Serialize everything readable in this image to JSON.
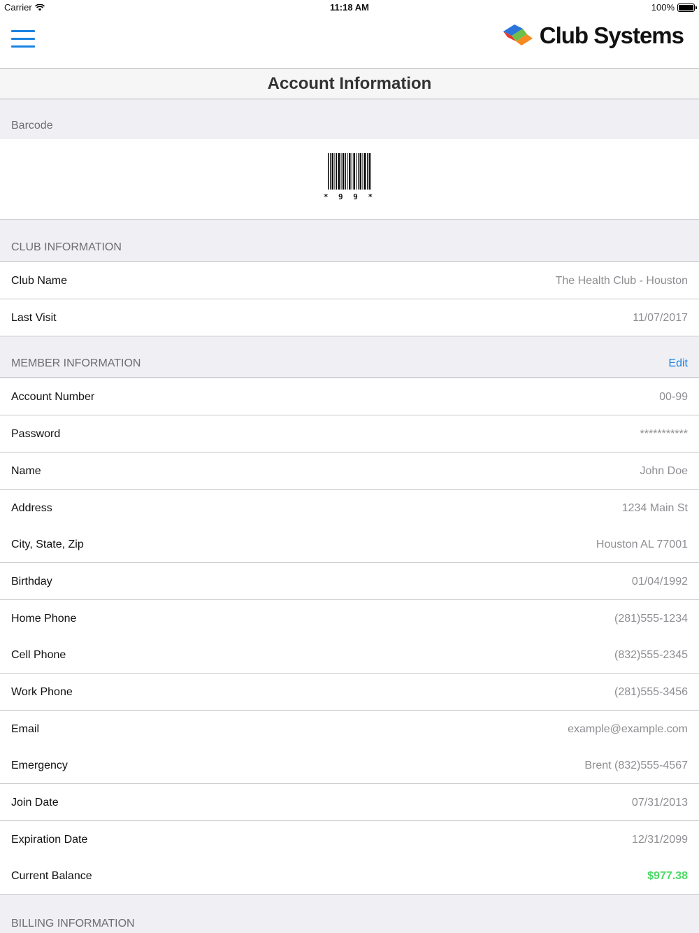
{
  "status_bar": {
    "carrier": "Carrier",
    "time": "11:18 AM",
    "battery": "100%"
  },
  "header": {
    "logo_text": "Club Systems",
    "menu_icon": "hamburger-menu-icon"
  },
  "page_title": "Account Information",
  "barcode": {
    "section_label": "Barcode",
    "text": "* 9 9 *"
  },
  "club": {
    "section_label": "CLUB INFORMATION",
    "rows": [
      {
        "label": "Club Name",
        "value": "The Health Club - Houston"
      },
      {
        "label": "Last Visit",
        "value": "11/07/2017"
      }
    ]
  },
  "member": {
    "section_label": "MEMBER INFORMATION",
    "edit_label": "Edit",
    "rows": [
      {
        "label": "Account Number",
        "value": "00-99"
      },
      {
        "label": "Password",
        "value": "***********"
      },
      {
        "label": "Name",
        "value": "John Doe"
      },
      {
        "label": "Address",
        "value": "1234 Main St"
      },
      {
        "label": "City, State, Zip",
        "value": "Houston AL 77001"
      },
      {
        "label": "Birthday",
        "value": "01/04/1992"
      },
      {
        "label": "Home Phone",
        "value": "(281)555-1234"
      },
      {
        "label": "Cell Phone",
        "value": "(832)555-2345"
      },
      {
        "label": "Work Phone",
        "value": "(281)555-3456"
      },
      {
        "label": "Email",
        "value": "example@example.com"
      },
      {
        "label": "Emergency",
        "value": "Brent (832)555-4567"
      },
      {
        "label": "Join Date",
        "value": "07/31/2013"
      },
      {
        "label": "Expiration Date",
        "value": "12/31/2099"
      },
      {
        "label": "Current Balance",
        "value": "$977.38"
      }
    ]
  },
  "billing": {
    "section_label": "BILLING INFORMATION"
  },
  "colors": {
    "accent": "#1a82e2",
    "balance": "#4cd964",
    "secondary_text": "#8e8e93",
    "section_bg": "#efeff4"
  }
}
